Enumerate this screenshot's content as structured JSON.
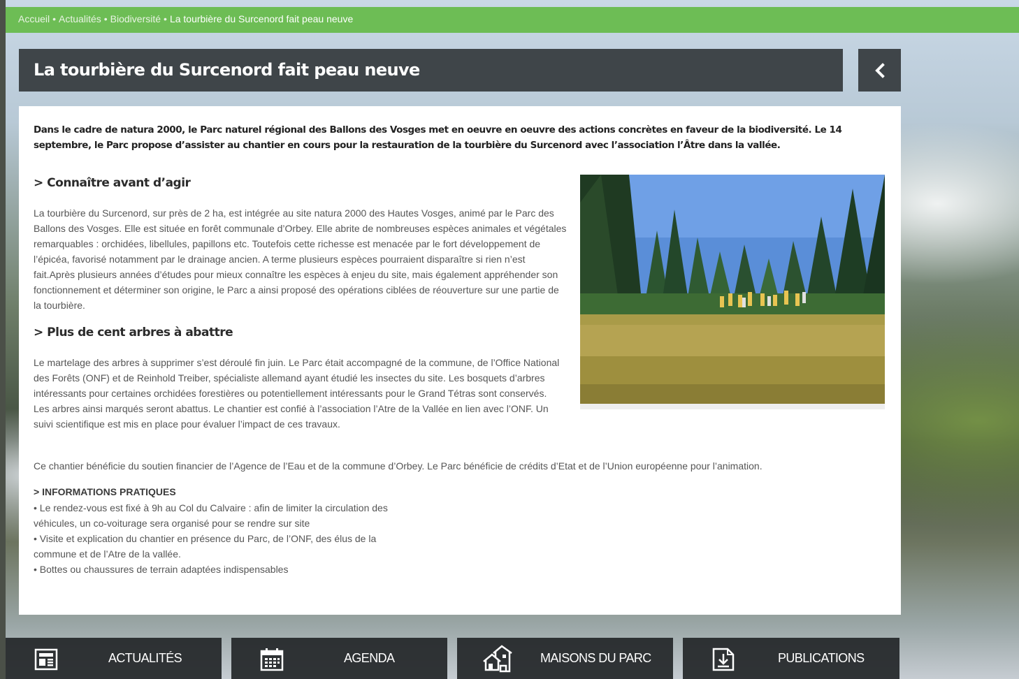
{
  "breadcrumb": {
    "items": [
      "Accueil",
      "Actualités",
      "Biodiversité"
    ],
    "separator": "•",
    "current": "La tourbière du Surcenord fait peau neuve"
  },
  "article": {
    "title": "La tourbière du Surcenord fait peau neuve",
    "lead": "Dans le cadre de natura 2000, le Parc naturel régional des Ballons des Vosges met en oeuvre en oeuvre des actions concrètes en faveur de la biodiversité. Le 14 septembre, le Parc propose d’assister au chantier en cours pour la restauration de la tourbière du Surcenord avec l’association l’Âtre dans la vallée.",
    "section1": {
      "title": "> Connaître avant d’agir",
      "text": "La tourbière du Surcenord, sur près de 2 ha, est intégrée au site natura 2000 des Hautes Vosges, animé par le Parc des Ballons des Vosges. Elle est située en forêt communale d’Orbey. Elle abrite de nombreuses espèces animales et végétales remarquables : orchidées, libellules, papillons etc. Toutefois cette richesse est menacée par le fort développement de l’épicéa, favorisé notamment par le drainage ancien. A terme plusieurs espèces pourraient disparaître si rien n’est fait.Après plusieurs années d’études pour mieux connaître les espèces à enjeu du site, mais également appréhender son fonctionnement et déterminer son origine, le Parc a ainsi proposé des opérations ciblées de réouverture sur une partie de la tourbière."
    },
    "section2": {
      "title": "> Plus de cent arbres à abattre",
      "text": "Le martelage des arbres à supprimer s’est déroulé fin juin. Le Parc était accompagné de la commune, de l’Office National des Forêts (ONF) et de Reinhold Treiber, spécialiste allemand ayant étudié les insectes du site. Les bosquets d’arbres intéressants pour certaines orchidées forestières ou potentiellement intéressants pour le Grand Tétras sont conservés. Les arbres ainsi marqués seront abattus. Le chantier est confié à l’association l’Atre de la Vallée en lien avec l’ONF. Un suivi scientifique est mis en place pour évaluer l’impact de ces travaux."
    },
    "funding": "Ce chantier bénéficie du soutien financier de l’Agence de l’Eau et de la commune d’Orbey. Le Parc bénéficie de crédits d’Etat et de l’Union européenne pour l’animation.",
    "info": {
      "title": "> INFORMATIONS PRATIQUES",
      "lines": [
        "• Le rendez-vous est fixé à 9h au Col du Calvaire : afin de limiter la circulation des",
        "véhicules, un co-voiturage sera organisé pour se rendre sur site",
        "• Visite et explication du chantier en présence du Parc, de l’ONF, des élus de la",
        "commune et de l’Atre de la vallée.",
        "• Bottes ou chaussures de terrain adaptées indispensables"
      ]
    }
  },
  "bottom_nav": [
    {
      "label": "ACTUALITÉS",
      "icon": "newspaper-icon"
    },
    {
      "label": "AGENDA",
      "icon": "calendar-icon"
    },
    {
      "label": "MAISONS DU PARC",
      "icon": "houses-icon"
    },
    {
      "label": "PUBLICATIONS",
      "icon": "download-document-icon"
    }
  ],
  "colors": {
    "breadcrumb_bg": "#6dbd55",
    "title_bg": "#3f4549",
    "nav_bg": "#232628"
  }
}
